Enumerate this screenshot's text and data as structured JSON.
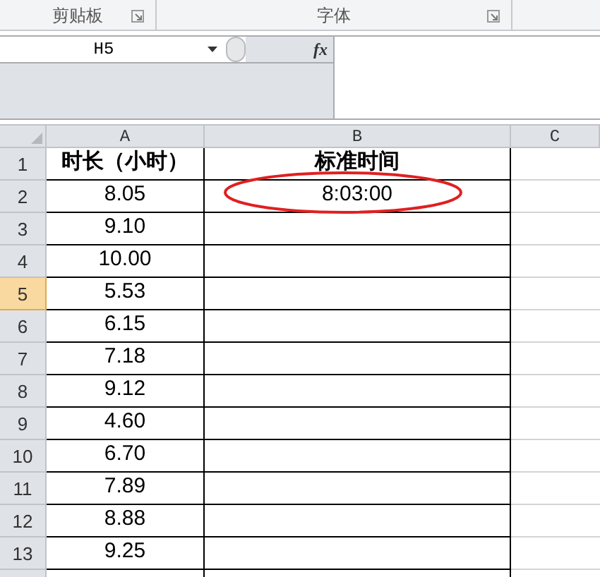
{
  "ribbon_groups": [
    {
      "label": "剪贴板"
    },
    {
      "label": "字体"
    }
  ],
  "formula_bar": {
    "name_box": "H5",
    "function_button": "fx"
  },
  "columns": [
    {
      "label": "A"
    },
    {
      "label": "B"
    },
    {
      "label": "C"
    }
  ],
  "rows": [
    {
      "number": "1",
      "selected": false,
      "cells": [
        "时长（小时）",
        "标准时间"
      ],
      "header": true
    },
    {
      "number": "2",
      "selected": false,
      "cells": [
        "8.05",
        "8:03:00"
      ],
      "header": false
    },
    {
      "number": "3",
      "selected": false,
      "cells": [
        "9.10"
      ],
      "header": false
    },
    {
      "number": "4",
      "selected": false,
      "cells": [
        "10.00"
      ],
      "header": false
    },
    {
      "number": "5",
      "selected": true,
      "cells": [
        "5.53"
      ],
      "header": false
    },
    {
      "number": "6",
      "selected": false,
      "cells": [
        "6.15"
      ],
      "header": false
    },
    {
      "number": "7",
      "selected": false,
      "cells": [
        "7.18"
      ],
      "header": false
    },
    {
      "number": "8",
      "selected": false,
      "cells": [
        "9.12"
      ],
      "header": false
    },
    {
      "number": "9",
      "selected": false,
      "cells": [
        "4.60"
      ],
      "header": false
    },
    {
      "number": "10",
      "selected": false,
      "cells": [
        "6.70"
      ],
      "header": false
    },
    {
      "number": "11",
      "selected": false,
      "cells": [
        "7.89"
      ],
      "header": false
    },
    {
      "number": "12",
      "selected": false,
      "cells": [
        "8.88"
      ],
      "header": false
    },
    {
      "number": "13",
      "selected": false,
      "cells": [
        "9.25"
      ],
      "header": false
    }
  ]
}
